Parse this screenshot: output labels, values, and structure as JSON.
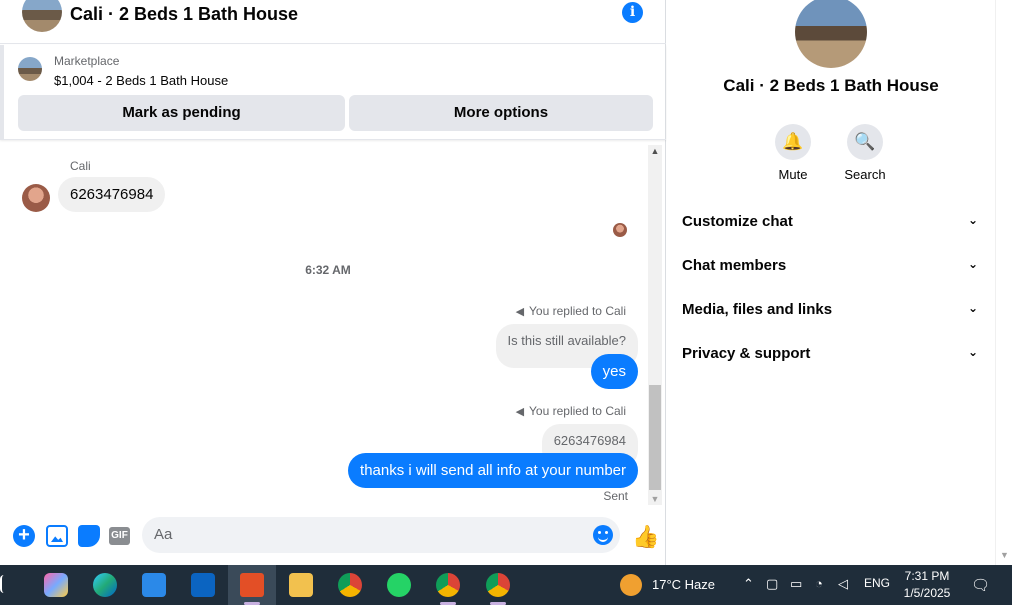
{
  "chat": {
    "header_title": "Cali · 2 Beds 1 Bath House",
    "marketplace_label": "Marketplace",
    "listing": "$1,004 - 2 Beds 1 Bath House",
    "mark_pending": "Mark as pending",
    "more_options": "More options",
    "sender_name": "Cali",
    "incoming_message": "6263476984",
    "timestamp": "6:32 AM",
    "reply1_label": "You replied to Cali",
    "reply1_quoted": "Is this still available?",
    "reply1_message": "yes",
    "reply2_label": "You replied to Cali",
    "reply2_quoted": "6263476984",
    "reply2_message": "thanks i will send all info at your number",
    "sent_status": "Sent",
    "composer_placeholder": "Aa"
  },
  "info_panel": {
    "title": "Cali · 2 Beds 1 Bath House",
    "mute": "Mute",
    "search": "Search",
    "sections": [
      "Customize chat",
      "Chat members",
      "Media, files and links",
      "Privacy & support"
    ]
  },
  "taskbar": {
    "weather": "17°C  Haze",
    "language": "ENG",
    "time": "7:31 PM",
    "date": "1/5/2025"
  },
  "colors": {
    "accent": "#0a7cff",
    "bubble_gray": "#f0f0f0",
    "taskbar": "#1f2d3a"
  },
  "icons": [
    "info-icon",
    "plus-icon",
    "photo-icon",
    "sticker-icon",
    "gif-icon",
    "emoji-icon",
    "like-icon",
    "bell-icon",
    "search-icon",
    "chevron-down-icon",
    "reply-arrow-icon"
  ]
}
